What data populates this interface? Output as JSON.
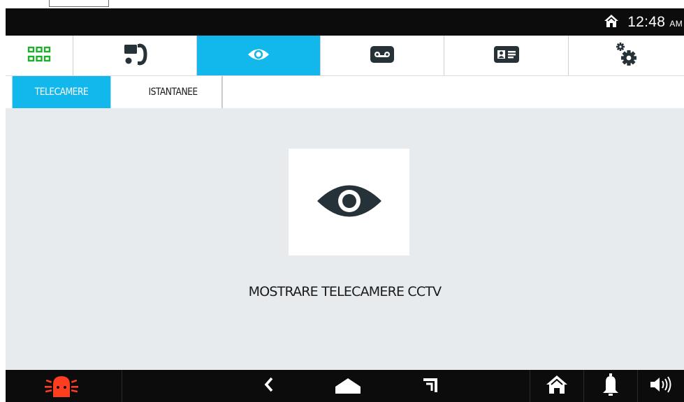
{
  "status_bar": {
    "home_icon": "home-icon",
    "time": "12:48",
    "ampm": "AM"
  },
  "nav_tabs": [
    {
      "icon": "apps-grid-icon",
      "active": false
    },
    {
      "icon": "intercom-call-icon",
      "active": false
    },
    {
      "icon": "eye-icon",
      "active": true
    },
    {
      "icon": "voicemail-icon",
      "active": false
    },
    {
      "icon": "contact-card-icon",
      "active": false
    },
    {
      "icon": "settings-gears-icon",
      "active": false
    }
  ],
  "sub_tabs": [
    {
      "label": "TELECAMERE",
      "active": true
    },
    {
      "label": "ISTANTANEE",
      "active": false
    }
  ],
  "main": {
    "card_icon": "eye-icon",
    "message": "MOSTRARE TELECAMERE CCTV"
  },
  "bottom_bar": {
    "items": [
      "alarm-icon",
      "back-icon",
      "home-shape-icon",
      "recent-apps-icon",
      "home-icon",
      "bell-icon",
      "volume-icon"
    ]
  },
  "colors": {
    "accent": "#12b8ec",
    "bar_dark": "#0c0c0c",
    "content_bg": "#e8ebee",
    "icon_dark": "#263238",
    "grid_green": "#1fae2e",
    "alarm_red": "#ff3d1f"
  }
}
